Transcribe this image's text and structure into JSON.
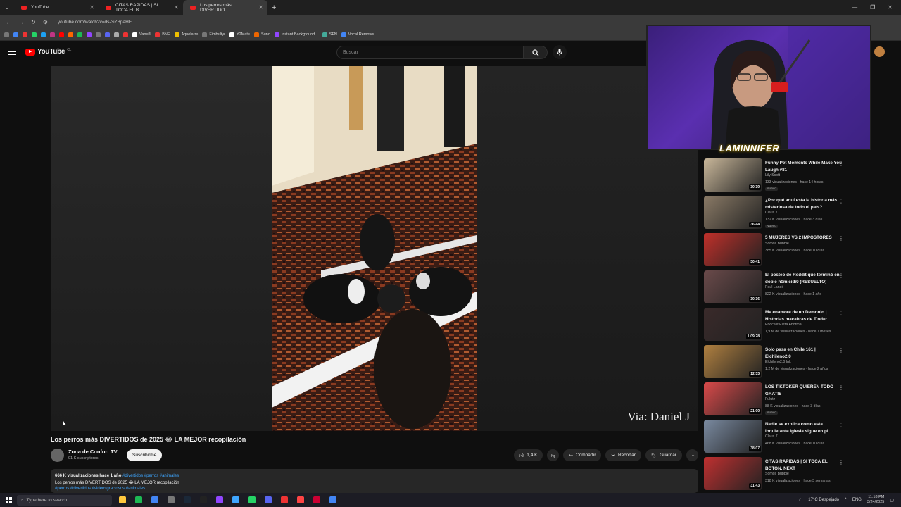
{
  "browser": {
    "tabs": [
      {
        "title": "YouTube",
        "active": false
      },
      {
        "title": "CITAS RAPIDAS | SI TOCA EL B",
        "active": false
      },
      {
        "title": "Los perros más DIVERTIDO",
        "active": true
      }
    ],
    "url": "youtube.com/watch?v=ds-3iZBpaHE",
    "bookmarks": [
      "Vans®",
      "BNE",
      "Aquelarre",
      "Fimbultyr",
      "Y2Mate",
      "Suno",
      "Instant Background...",
      "SFN",
      "Vocal Remover"
    ]
  },
  "yt": {
    "logo_text": "YouTube",
    "logo_country": "CL",
    "search_placeholder": "Buscar"
  },
  "player": {
    "watermark": "Via: Daniel J"
  },
  "overlay": {
    "streamer_name": "LAMINNIFER"
  },
  "video": {
    "title": "Los perros más DIVERTIDOS de 2025 😂 LA MEJOR recopilación",
    "channel": "Zona de Confort TV",
    "subscribers": "91 K suscriptores",
    "subscribe_label": "Suscribirme",
    "likes": "1,4 K",
    "share_label": "Compartir",
    "clip_label": "Recortar",
    "save_label": "Guardar",
    "desc_meta": "666 K visualizaciones  hace 1 año",
    "desc_tags_1": "#divertidos #perros #animales",
    "desc_line": "Los perros más DIVERTIDOS de 2025 😂 LA MEJOR recopilación",
    "desc_tags_2": "#perros #divertidos #videosgraciosos #animales"
  },
  "recommendations": [
    {
      "title": "Funny Pet Moments While Make You Laugh #81",
      "channel": "Lily Scott",
      "views": "133 visualizaciones · hace 14 horas",
      "badge": "Nuevo",
      "duration": "30:39",
      "color": "#c9b79a"
    },
    {
      "title": "¿Por qué aquí esta la historia más misteriosa de todo el país?",
      "channel": "Claus.7",
      "views": "132 K visualizaciones · hace 3 días",
      "badge": "Nuevo",
      "duration": "36:44",
      "color": "#8a7a66"
    },
    {
      "title": "5 MUJERES VS 2 IMPOSTORES",
      "channel": "Somos Bubble",
      "views": "385 K visualizaciones · hace 10 días",
      "badge": "",
      "duration": "30:41",
      "color": "#c0302a"
    },
    {
      "title": "El posteo de Reddit que terminó en doble h0micidi0 (RESUELTO)",
      "channel": "Paul Landó",
      "views": "822 K visualizaciones · hace 1 año",
      "badge": "",
      "duration": "30:36",
      "color": "#6a4a4a"
    },
    {
      "title": "Me enamoré de un Demonio | Historias macabras de Tinder",
      "channel": "Podcast Extra Anormal",
      "views": "1,9 M de visualizaciones · hace 7 meses",
      "badge": "",
      "duration": "1:09:28",
      "color": "#3a2a2a"
    },
    {
      "title": "Solo pasa en Chile 161 | Elchileno2.0",
      "channel": "Elchileno2.0 Inf.",
      "views": "1,2 M de visualizaciones · hace 2 años",
      "badge": "",
      "duration": "12:33",
      "color": "#b08040"
    },
    {
      "title": "LOS TIKTOKER QUIEREN TODO GRATIS",
      "channel": "Fulutz",
      "views": "88 K visualizaciones · hace 3 días",
      "badge": "Nuevo",
      "duration": "21:00",
      "color": "#d94a4a"
    },
    {
      "title": "Nadie se explica como esta inquietante iglesia sigue en pi...",
      "channel": "Claus.7",
      "views": "468 K visualizaciones · hace 10 días",
      "badge": "",
      "duration": "38:07",
      "color": "#7a8aa0"
    },
    {
      "title": "CITAS RAPIDAS | SI TOCA EL BOTON, NEXT",
      "channel": "Somos Bubble",
      "views": "318 K visualizaciones · hace 3 semanas",
      "badge": "",
      "duration": "31:43",
      "color": "#c03030"
    }
  ],
  "taskbar": {
    "search_placeholder": "Type here to search",
    "weather": "17°C  Despejado",
    "lang": "ENG",
    "time": "11:18 PM",
    "date": "3/24/2025"
  }
}
